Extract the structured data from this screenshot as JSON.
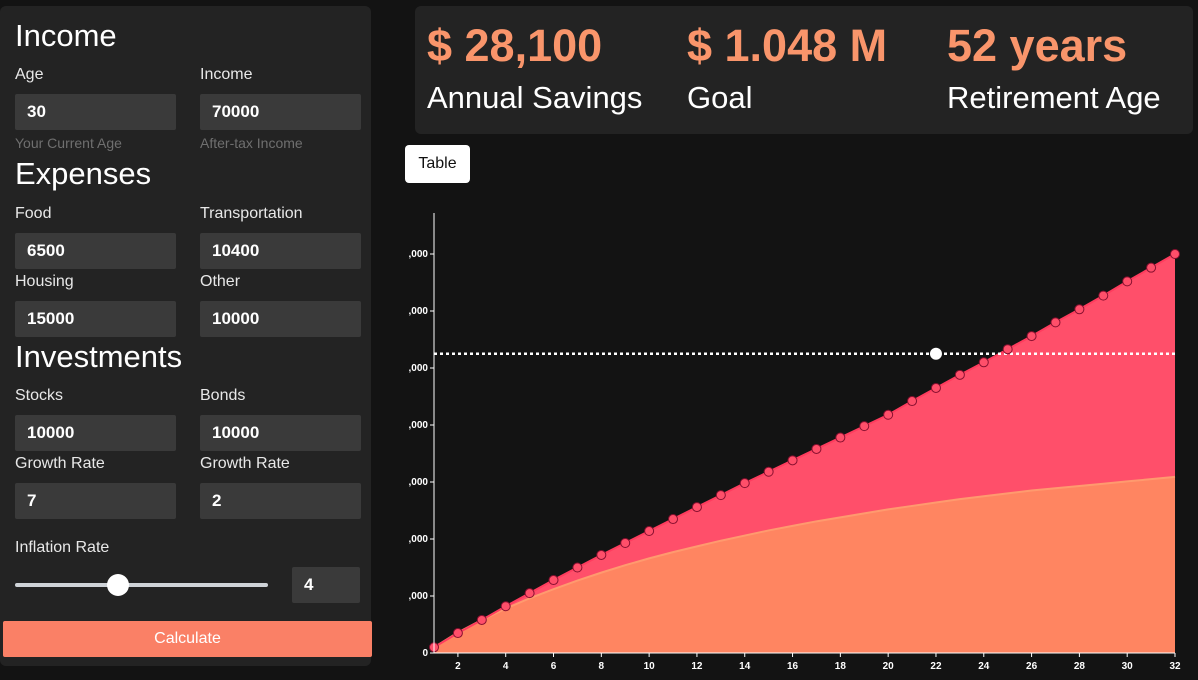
{
  "sidebar": {
    "income": {
      "title": "Income",
      "age_label": "Age",
      "age_value": "30",
      "age_helper": "Your Current Age",
      "income_label": "Income",
      "income_value": "70000",
      "income_helper": "After-tax Income"
    },
    "expenses": {
      "title": "Expenses",
      "food_label": "Food",
      "food_value": "6500",
      "transportation_label": "Transportation",
      "transportation_value": "10400",
      "housing_label": "Housing",
      "housing_value": "15000",
      "other_label": "Other",
      "other_value": "10000"
    },
    "investments": {
      "title": "Investments",
      "stocks_label": "Stocks",
      "stocks_value": "10000",
      "bonds_label": "Bonds",
      "bonds_value": "10000",
      "stocks_growth_label": "Growth Rate",
      "stocks_growth_value": "7",
      "bonds_growth_label": "Growth Rate",
      "bonds_growth_value": "2"
    },
    "inflation": {
      "label": "Inflation Rate",
      "value": "4",
      "slider_fraction": 0.4
    },
    "calculate_label": "Calculate"
  },
  "stats": {
    "annual_savings_value": "$ 28,100",
    "annual_savings_label": "Annual Savings",
    "goal_value": "$ 1.048 M",
    "goal_label": "Goal",
    "retirement_value": "52 years",
    "retirement_label": "Retirement Age"
  },
  "table_button_label": "Table",
  "colors": {
    "accent": "#f9956b",
    "button": "#fa8066",
    "area_top": "#ff4f6a",
    "area_bottom": "#ff8561",
    "panel": "#232323",
    "background": "#131313"
  },
  "chart_data": {
    "type": "area",
    "x": [
      1,
      2,
      3,
      4,
      5,
      6,
      7,
      8,
      9,
      10,
      11,
      12,
      13,
      14,
      15,
      16,
      17,
      18,
      19,
      20,
      21,
      22,
      23,
      24,
      25,
      26,
      27,
      28,
      29,
      30,
      31,
      32
    ],
    "xlim": [
      1,
      32
    ],
    "x_ticks": [
      2,
      4,
      6,
      8,
      10,
      12,
      14,
      16,
      18,
      20,
      22,
      24,
      26,
      28,
      30,
      32
    ],
    "y_ticks": [
      0,
      1,
      2,
      3,
      4,
      5,
      6,
      7
    ],
    "y_tick_labels": [
      "0",
      ",000",
      ",000",
      ",000",
      ",000",
      ",000",
      ",000",
      ",000"
    ],
    "ylim": [
      0,
      7.5
    ],
    "series": [
      {
        "values": [
          0.1,
          0.35,
          0.58,
          0.82,
          1.05,
          1.28,
          1.5,
          1.72,
          1.93,
          2.14,
          2.35,
          2.56,
          2.77,
          2.98,
          3.18,
          3.38,
          3.58,
          3.78,
          3.98,
          4.18,
          4.42,
          4.65,
          4.88,
          5.1,
          5.33,
          5.56,
          5.8,
          6.03,
          6.27,
          6.52,
          6.76,
          7.0
        ],
        "color": "#ff4f6a",
        "markers": true
      },
      {
        "values": [
          0.1,
          0.36,
          0.58,
          0.78,
          0.96,
          1.12,
          1.27,
          1.41,
          1.54,
          1.66,
          1.77,
          1.87,
          1.97,
          2.06,
          2.15,
          2.23,
          2.31,
          2.38,
          2.45,
          2.52,
          2.58,
          2.64,
          2.7,
          2.75,
          2.8,
          2.85,
          2.89,
          2.93,
          2.97,
          3.01,
          3.05,
          3.09
        ],
        "color": "#ff8561",
        "markers": false
      }
    ],
    "goal_line": 5.25,
    "highlight_point": {
      "x": 22,
      "y": 5.25
    }
  }
}
